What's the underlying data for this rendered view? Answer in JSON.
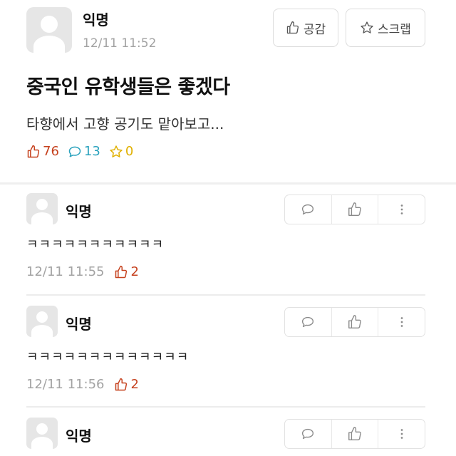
{
  "post": {
    "author": "익명",
    "time": "12/11 11:52",
    "title": "중국인 유학생들은 좋겠다",
    "body": "타향에서 고향 공기도 맡아보고...",
    "like_button": "공감",
    "scrap_button": "스크랩",
    "likes": "76",
    "comments": "13",
    "scraps": "0"
  },
  "comments": [
    {
      "author": "익명",
      "text": "ㅋㅋㅋㅋㅋㅋㅋㅋㅋㅋㅋ",
      "time": "12/11 11:55",
      "votes": "2"
    },
    {
      "author": "익명",
      "text": "ㅋㅋㅋㅋㅋㅋㅋㅋㅋㅋㅋㅋㅋ",
      "time": "12/11 11:56",
      "votes": "2"
    },
    {
      "author": "익명"
    }
  ],
  "icons": {
    "thumbs_up": "thumbs-up-icon",
    "star": "star-icon",
    "comment": "comment-icon",
    "more": "more-vertical-icon"
  },
  "colors": {
    "like": "#c6421f",
    "comment": "#2aa2bd",
    "scrap": "#e0b000",
    "muted": "#a3a3a3"
  }
}
